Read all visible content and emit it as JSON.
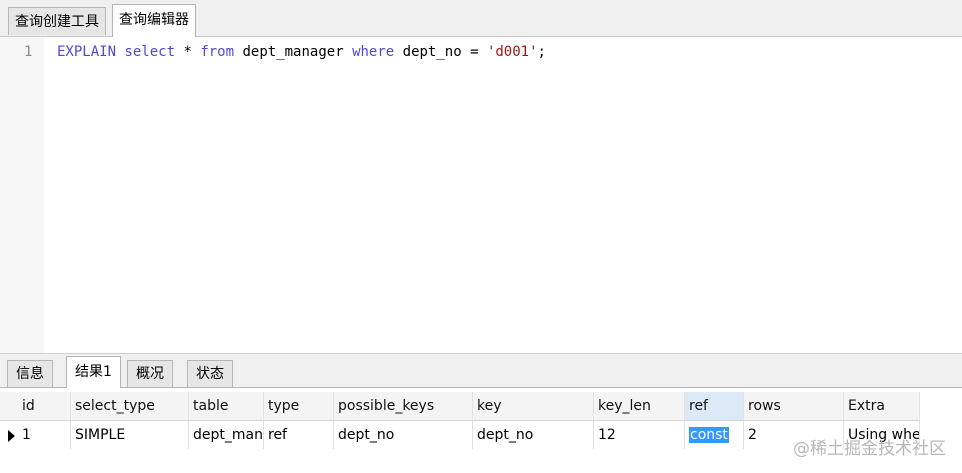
{
  "top_tabs": [
    "查询创建工具",
    "查询编辑器"
  ],
  "top_active_tab": 1,
  "editor": {
    "line_number": "1",
    "tokens": {
      "explain": "EXPLAIN",
      "select": "select",
      "star": " * ",
      "from": "from",
      "table": " dept_manager ",
      "where": "where",
      "cond": " dept_no = ",
      "value": "'d001'",
      "end": ";"
    }
  },
  "bottom_tabs": [
    "信息",
    "结果1",
    "概况",
    "状态"
  ],
  "bottom_active_tab": 1,
  "result": {
    "columns": [
      "id",
      "select_type",
      "table",
      "type",
      "possible_keys",
      "key",
      "key_len",
      "ref",
      "rows",
      "Extra"
    ],
    "row": [
      "1",
      "SIMPLE",
      "dept_man",
      "ref",
      "dept_no",
      "dept_no",
      "12",
      "const",
      "2",
      "Using whe"
    ]
  },
  "watermark": "@稀土掘金技术社区",
  "colors": {
    "keyword": "#4a4ad8",
    "string": "#a31515",
    "selection": "#3399ff"
  }
}
